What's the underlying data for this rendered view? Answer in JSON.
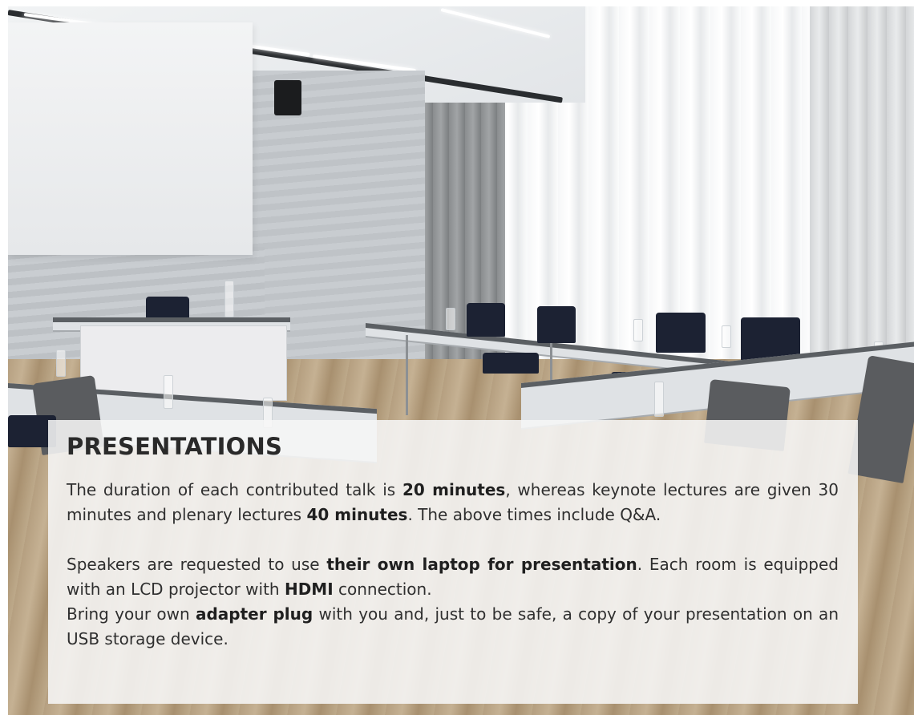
{
  "section": {
    "title": "PRESENTATIONS",
    "paragraph1": {
      "t1": "The duration of each contributed talk is ",
      "b1": "20 minutes",
      "t2": ", whereas keynote lec­tures are given 30 minutes and plenary lectures ",
      "b2": "40 minutes",
      "t3": ". The above times include Q&A."
    },
    "paragraph2": {
      "t1": "Speakers are requested to use ",
      "b1": "their own laptop for presentation",
      "t2": ". Each room is equipped with an LCD projector with ",
      "b2": "HDMI",
      "t3": " connection.",
      "t4": "Bring your own ",
      "b3": "adapter plug",
      "t5": " with you and, just to be safe, a copy of your presentation on an USB storage device."
    }
  }
}
